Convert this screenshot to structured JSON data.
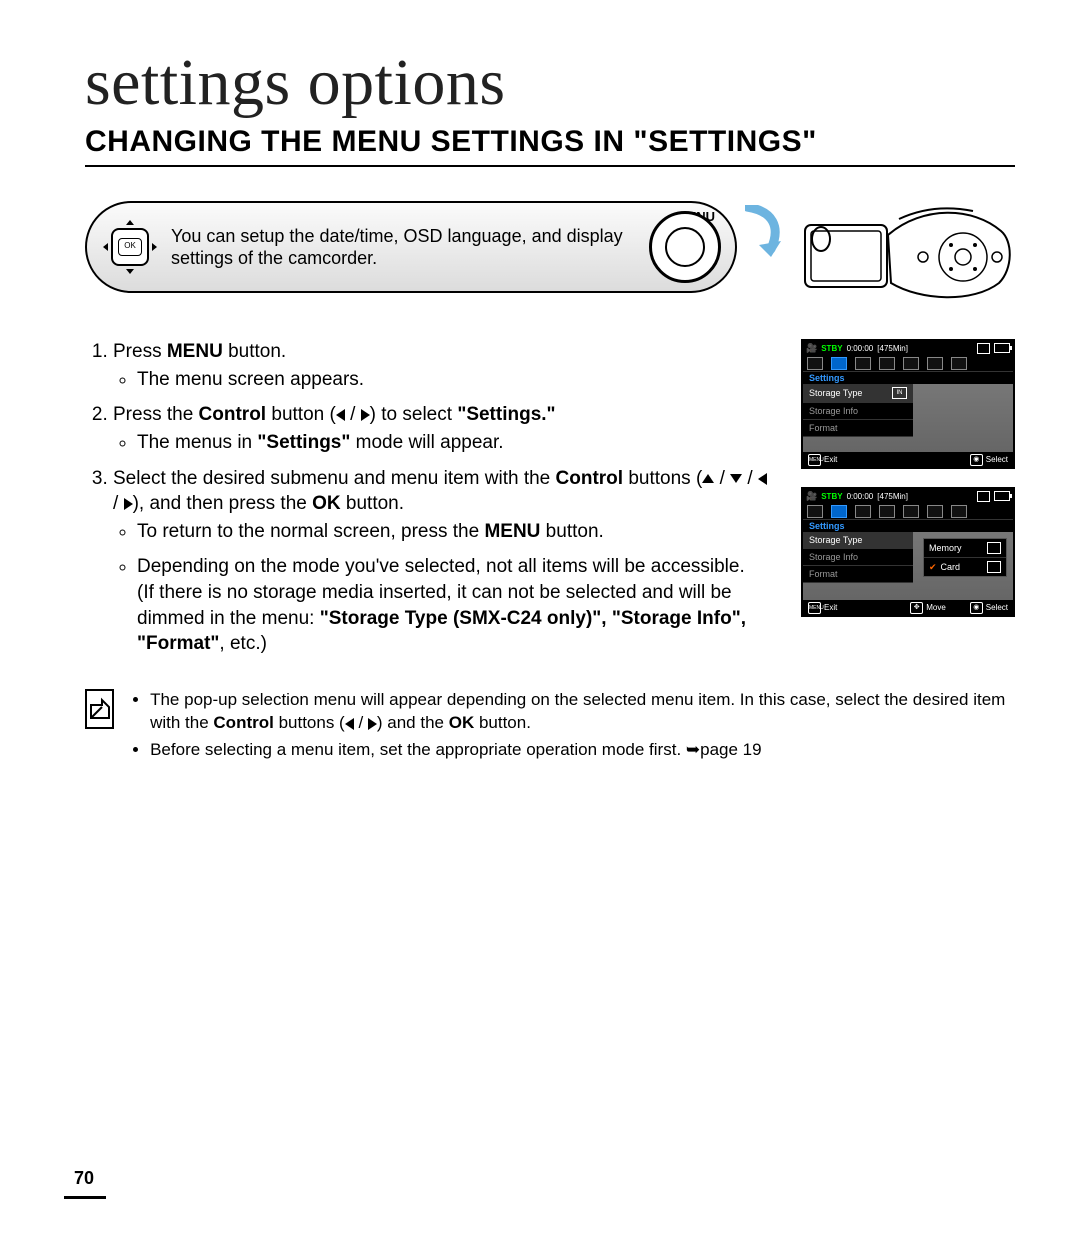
{
  "page": {
    "title": "settings options",
    "section_heading": "CHANGING THE MENU SETTINGS IN \"SETTINGS\"",
    "number": "70"
  },
  "info_bar": {
    "text": "You can setup the date/time, OSD language, and display settings of the camcorder.",
    "ok_label": "OK",
    "menu_label": "MENU"
  },
  "steps": {
    "s1": {
      "pre": "Press ",
      "bold": "MENU",
      "post": " button.",
      "sub1": "The menu screen appears."
    },
    "s2": {
      "pre": "Press the ",
      "bold1": "Control",
      "mid1": " button (",
      "mid2": " / ",
      "post1": ") to select ",
      "bold2": "\"Settings.\"",
      "sub1_pre": "The menus in ",
      "sub1_bold": "\"Settings\"",
      "sub1_post": " mode will appear."
    },
    "s3": {
      "pre": "Select the desired submenu and menu item with the ",
      "bold1": "Control",
      "mid1": " buttons (",
      "mid_sep": " / ",
      "mid2": "), and then press the ",
      "bold2": "OK",
      "post": " button.",
      "sub1_pre": "To return to the normal screen, press the ",
      "sub1_bold": "MENU",
      "sub1_post": " button.",
      "sub2": "Depending on the mode you've selected, not all items will be accessible.",
      "sub2b_pre": "(If there is no storage media inserted, it can not be selected and will be dimmed in the menu: ",
      "sub2b_bold": "\"Storage Type (SMX-C24 only)\", \"Storage Info\", \"Format\"",
      "sub2b_post": ", etc.)"
    }
  },
  "notes": {
    "n1_pre": "The pop-up selection menu will appear depending on the selected menu item. In this case, select the desired item with the ",
    "n1_bold1": "Control",
    "n1_mid": " buttons (",
    "n1_sep": " / ",
    "n1_mid2": ") and the ",
    "n1_bold2": "OK",
    "n1_post": " button.",
    "n2_pre": "Before selecting a menu item, set the appropriate operation mode first. ➥",
    "n2_post": "page 19"
  },
  "lcd": {
    "stby": "STBY",
    "timecode": "0:00:00",
    "remain": "[475Min]",
    "category": "Settings",
    "items": {
      "storage_type": "Storage Type",
      "storage_info": "Storage Info",
      "format": "Format"
    },
    "chip_label": "IN",
    "footer": {
      "menu_sym": "MENU",
      "exit": "Exit",
      "select": "Select",
      "move": "Move"
    },
    "popup": {
      "memory": "Memory",
      "card": "Card"
    }
  }
}
